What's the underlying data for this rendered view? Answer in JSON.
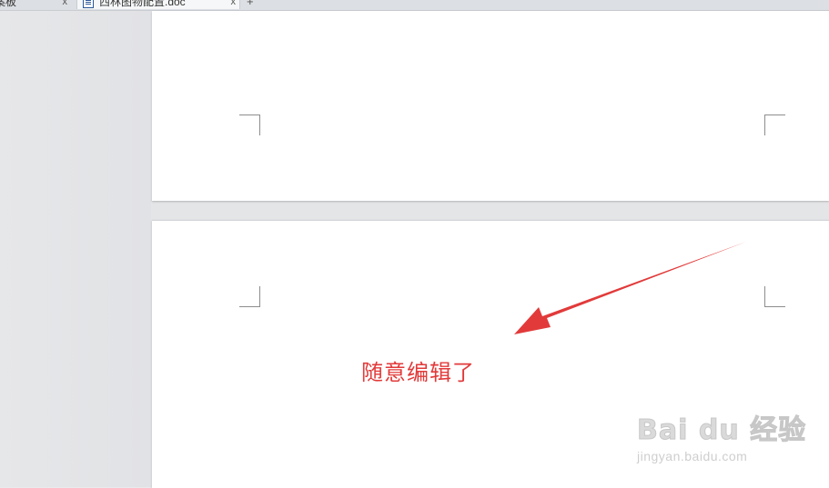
{
  "tabs": [
    {
      "label": "案板",
      "close": "x"
    },
    {
      "label": "西林图物配置.doc",
      "close": "x"
    }
  ],
  "new_tab": "+",
  "annotation": {
    "text": "随意编辑了",
    "color": "#e23a3a"
  },
  "watermark": {
    "logo": "Bai du 经验",
    "url": "jingyan.baidu.com"
  },
  "colors": {
    "page": "#ffffff",
    "canvas": "#e4e5e7",
    "accent": "#e23a3a"
  }
}
